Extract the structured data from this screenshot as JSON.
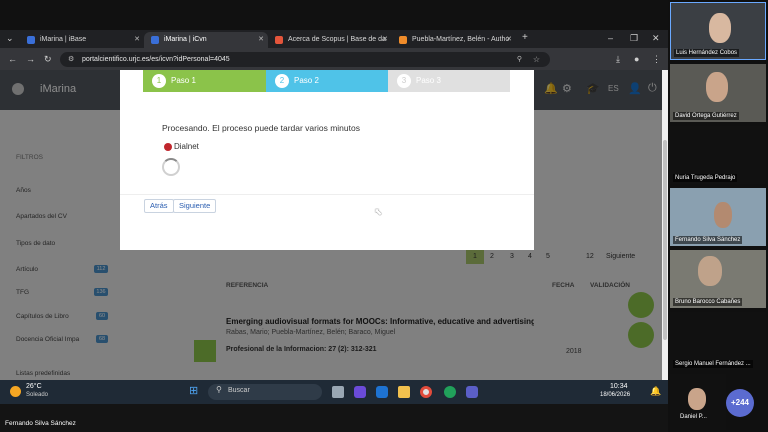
{
  "browser": {
    "tabs": [
      {
        "label": "iMarina | iBase",
        "fav_color": "#3a6fd8"
      },
      {
        "label": "iMarina | iCvn",
        "fav_color": "#3a6fd8"
      },
      {
        "label": "Acerca de Scopus | Base de da",
        "fav_color": "#e4553b"
      },
      {
        "label": "Puebla-Martínez, Belén - Autho",
        "fav_color": "#f08c2a"
      }
    ],
    "new_tab": "+",
    "url": "portalcientifico.urjc.es/es/icvn?idPersonal=4045"
  },
  "app": {
    "name": "iMarina",
    "lang": "ES"
  },
  "sidebar": {
    "title": "FILTROS",
    "items": [
      {
        "label": "Años"
      },
      {
        "label": "Apartados del CV"
      },
      {
        "label": "Tipos de dato"
      },
      {
        "label": "Artículo",
        "count": "112"
      },
      {
        "label": "TFG",
        "count": "136"
      },
      {
        "label": "Capítulos de Libro",
        "count": "60"
      },
      {
        "label": "Docencia Oficial Impa",
        "count": "68"
      },
      {
        "label": "Listas predefinidas"
      }
    ]
  },
  "list": {
    "col_ref": "REFERENCIA",
    "col_date": "FECHA",
    "col_valid": "VALIDACIÓN",
    "page_last": "12",
    "pages": [
      "1",
      "2",
      "3",
      "4",
      "5"
    ],
    "next": "Siguiente",
    "item_title": "Emerging audiovisual formats for MOOCs: Informative, educative and advertising desi",
    "item_authors": "Rabas, Mario; Puebla-Martínez, Belén; Baraco, Miguel",
    "item_source": "Profesional de la Informacion: 27 (2): 312-321",
    "item_year": "2018"
  },
  "modal": {
    "steps": [
      {
        "num": "1",
        "label": "Paso 1",
        "color": "#8bc34a"
      },
      {
        "num": "2",
        "label": "Paso 2",
        "color": "#4fc3e8"
      },
      {
        "num": "3",
        "label": "Paso 3",
        "color": "#e0e0e0"
      }
    ],
    "message": "Procesando. El proceso puede tardar varios minutos",
    "source": "Dialnet",
    "back": "Atrás",
    "next": "Siguiente"
  },
  "taskbar": {
    "weather_temp": "26°C",
    "weather_desc": "Soleado",
    "search": "Buscar",
    "time": "10:34",
    "date": "18/06/2026"
  },
  "meeting": {
    "participants": [
      {
        "name": "Luis Hernández Cobos"
      },
      {
        "name": "David Ortega Gutiérrez"
      },
      {
        "name": "Nuria Trugeda Pedrajo"
      },
      {
        "name": "Fernando Silva Sánchez"
      },
      {
        "name": "Bruno Barocco Cabañes"
      },
      {
        "name": "Sergio Manuel Fernández ..."
      },
      {
        "name": "Daniel P..."
      }
    ],
    "more": "+244",
    "self_name": "Fernando Silva Sánchez"
  }
}
